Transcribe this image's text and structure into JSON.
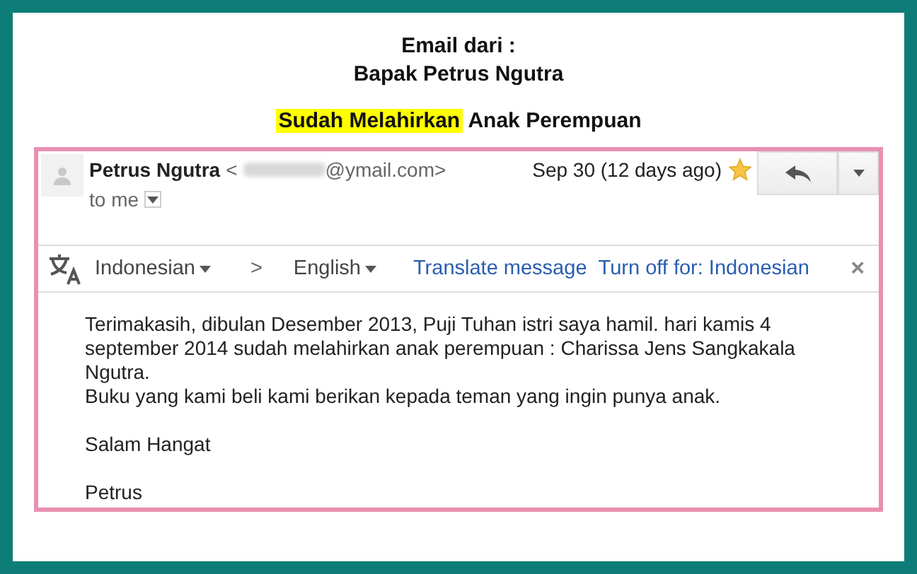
{
  "heading": {
    "line_1": "Email dari :",
    "line_2": "Bapak Petrus Ngutra"
  },
  "headline": {
    "highlight": "Sudah Melahirkan",
    "rest": "Anak Perempuan"
  },
  "email": {
    "sender_name": "Petrus Ngutra",
    "address_open": "<",
    "address_domain": "@ymail.com>",
    "date": "Sep 30 (12 days ago)",
    "starred": true,
    "recipient": "to me",
    "translate_bar": {
      "from": "Indonesian",
      "separator": ">",
      "to": "English",
      "translate_link": "Translate message",
      "turn_off_link": "Turn off for: Indonesian",
      "close": "×"
    },
    "body": [
      [
        "Terimakasih, dibulan Desember 2013, Puji Tuhan istri saya hamil. hari kamis 4 september 2014 sudah melahirkan anak perempuan : Charissa Jens Sangkakala Ngutra.",
        "Buku yang kami beli kami berikan kepada teman yang ingin punya anak."
      ],
      [
        "Salam Hangat"
      ],
      [
        "Petrus"
      ]
    ]
  }
}
